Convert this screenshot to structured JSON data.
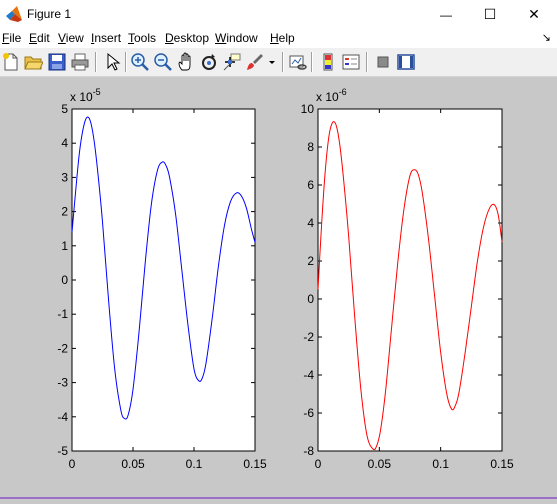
{
  "window": {
    "title": "Figure 1",
    "minimize_glyph": "—",
    "maximize_glyph": "☐",
    "close_glyph": "✕",
    "dock_glyph": "↘"
  },
  "menu": [
    "File",
    "Edit",
    "View",
    "Insert",
    "Tools",
    "Desktop",
    "Window",
    "Help"
  ],
  "toolbar": {
    "icons": [
      "new-figure-icon",
      "open-file-icon",
      "save-icon",
      "print-icon",
      "edit-plot-icon",
      "zoom-in-icon",
      "zoom-out-icon",
      "pan-icon",
      "rotate-3d-icon",
      "data-cursor-icon",
      "brush-icon",
      "brush-dropdown-icon",
      "link-plot-icon",
      "insert-colorbar-icon",
      "insert-legend-icon",
      "hide-plot-tools-icon",
      "show-plot-tools-icon"
    ]
  },
  "colors": {
    "figure_bg": "#c8c8c8",
    "series1": "#0000ff",
    "series2": "#ff0000"
  },
  "chart_data": [
    {
      "type": "line",
      "exponent_label": "x 10",
      "exponent": "-5",
      "xlim": [
        0,
        0.15
      ],
      "ylim": [
        -5,
        5
      ],
      "x_ticks": [
        "0",
        "0.05",
        "0.1",
        "0.15"
      ],
      "y_ticks": [
        "5",
        "4",
        "3",
        "2",
        "1",
        "0",
        "-1",
        "-2",
        "-3",
        "-4",
        "-5"
      ],
      "series": [
        {
          "color": "#0000ff",
          "x": [
            0,
            0.003,
            0.006,
            0.009,
            0.012,
            0.015,
            0.018,
            0.021,
            0.025,
            0.03,
            0.035,
            0.04,
            0.043,
            0.046,
            0.05,
            0.055,
            0.06,
            0.065,
            0.07,
            0.074,
            0.077,
            0.08,
            0.085,
            0.09,
            0.095,
            0.1,
            0.104,
            0.107,
            0.11,
            0.115,
            0.12,
            0.125,
            0.13,
            0.135,
            0.139,
            0.143,
            0.147,
            0.15
          ],
          "y": [
            1.4,
            2.6,
            3.7,
            4.4,
            4.75,
            4.65,
            4.1,
            3.2,
            1.7,
            -0.6,
            -2.6,
            -3.8,
            -4.05,
            -3.95,
            -3.2,
            -1.5,
            0.5,
            2.2,
            3.2,
            3.45,
            3.35,
            3.0,
            1.9,
            0.3,
            -1.3,
            -2.6,
            -2.95,
            -2.85,
            -2.4,
            -1.1,
            0.4,
            1.6,
            2.3,
            2.55,
            2.45,
            2.1,
            1.5,
            1.1
          ]
        }
      ]
    },
    {
      "type": "line",
      "exponent_label": "x 10",
      "exponent": "-6",
      "xlim": [
        0,
        0.15
      ],
      "ylim": [
        -8,
        10
      ],
      "x_ticks": [
        "0",
        "0.05",
        "0.1",
        "0.15"
      ],
      "y_ticks": [
        "10",
        "8",
        "6",
        "4",
        "2",
        "0",
        "-2",
        "-4",
        "-6",
        "-8"
      ],
      "series": [
        {
          "color": "#ff0000",
          "x": [
            0,
            0.003,
            0.006,
            0.009,
            0.012,
            0.015,
            0.018,
            0.021,
            0.025,
            0.03,
            0.035,
            0.04,
            0.045,
            0.048,
            0.051,
            0.055,
            0.06,
            0.065,
            0.07,
            0.075,
            0.079,
            0.082,
            0.085,
            0.09,
            0.095,
            0.1,
            0.105,
            0.109,
            0.112,
            0.115,
            0.12,
            0.125,
            0.13,
            0.135,
            0.14,
            0.144,
            0.147,
            0.15
          ],
          "y": [
            0.5,
            4.0,
            6.8,
            8.6,
            9.3,
            9.1,
            8.0,
            6.2,
            3.3,
            -1.0,
            -4.8,
            -7.2,
            -7.9,
            -7.7,
            -6.9,
            -4.9,
            -1.5,
            1.9,
            4.7,
            6.5,
            6.8,
            6.5,
            5.6,
            3.2,
            0.2,
            -2.8,
            -5.0,
            -5.8,
            -5.6,
            -4.9,
            -2.8,
            -0.4,
            2.0,
            3.8,
            4.8,
            4.95,
            4.4,
            3.0
          ]
        }
      ]
    }
  ]
}
